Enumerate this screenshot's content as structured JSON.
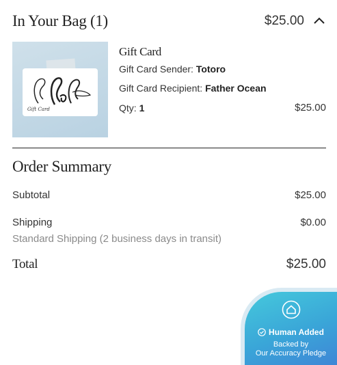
{
  "bag": {
    "title": "In Your Bag (1)",
    "total": "$25.00"
  },
  "item": {
    "name": "Gift Card",
    "sender_label": "Gift Card Sender:",
    "sender_value": "Totoro",
    "recipient_label": "Gift Card Recipient:",
    "recipient_value": "Father Ocean",
    "qty_label": "Qty:",
    "qty_value": "1",
    "price": "$25.00",
    "image_card_text": "Gift Card"
  },
  "summary": {
    "title": "Order Summary",
    "subtotal_label": "Subtotal",
    "subtotal_value": "$25.00",
    "shipping_label": "Shipping",
    "shipping_value": "$0.00",
    "shipping_note": "Standard Shipping (2 business days in transit)",
    "total_label": "Total",
    "total_value": "$25.00"
  },
  "badge": {
    "line1": "Human Added",
    "line2": "Backed by",
    "line3": "Our Accuracy Pledge"
  },
  "icons": {
    "collapse": "chevron-up-icon",
    "badge": "home-shield-icon",
    "check": "check-circle-icon"
  },
  "colors": {
    "text": "#222222",
    "muted": "#8a8a8a",
    "image_bg": "#c4d9e6",
    "badge_start": "#45c9dc",
    "badge_end": "#3f86d6"
  }
}
